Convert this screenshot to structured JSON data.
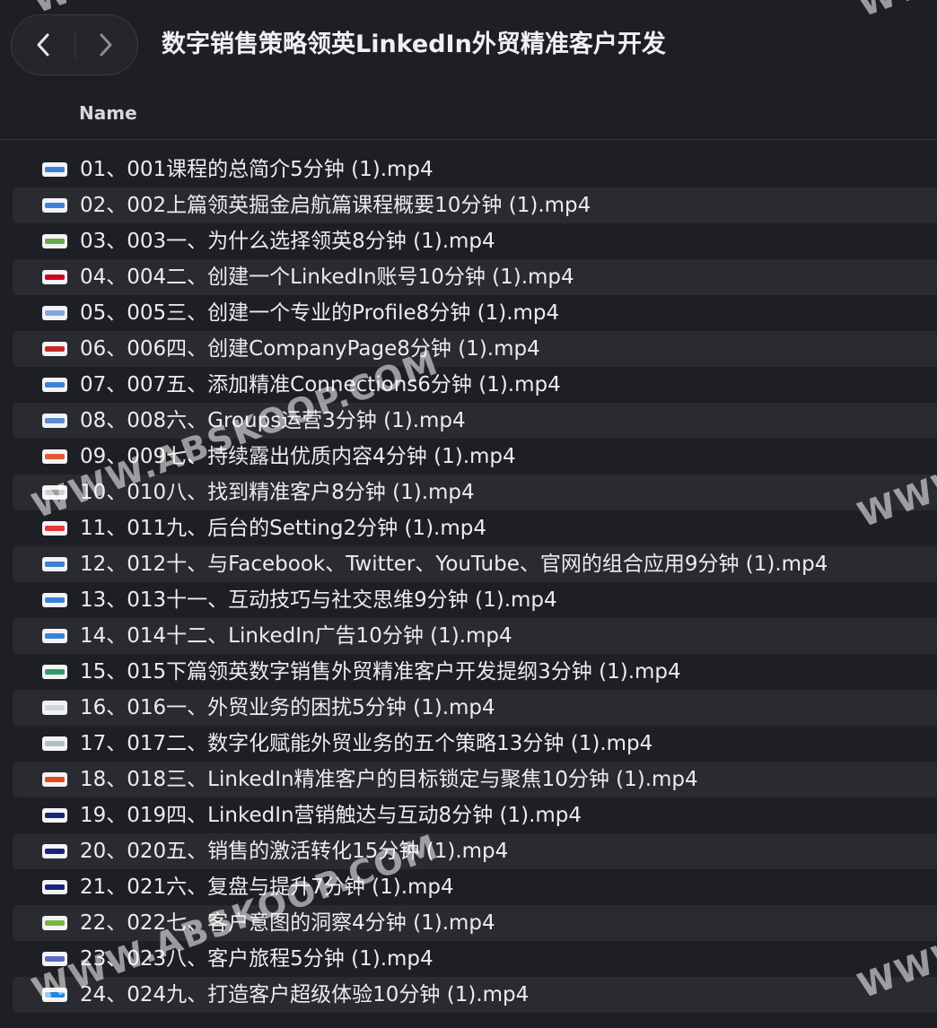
{
  "window": {
    "title": "数字销售策略领英LinkedIn外贸精准客户开发",
    "back_icon": "chevron-left-icon",
    "forward_icon": "chevron-right-icon"
  },
  "list": {
    "column_header": "Name",
    "files": [
      {
        "name": "01、001课程的总简介5分钟 (1).mp4",
        "icon_color": "#3b82d6"
      },
      {
        "name": "02、002上篇领英掘金启航篇课程概要10分钟 (1).mp4",
        "icon_color": "#3b82d6"
      },
      {
        "name": "03、003一、为什么选择领英8分钟 (1).mp4",
        "icon_color": "#6aa84f"
      },
      {
        "name": "04、004二、创建一个LinkedIn账号10分钟 (1).mp4",
        "icon_color": "#d0021b"
      },
      {
        "name": "05、005三、创建一个专业的Profile8分钟 (1).mp4",
        "icon_color": "#7fa7e0"
      },
      {
        "name": "06、006四、创建CompanyPage8分钟 (1).mp4",
        "icon_color": "#c62828"
      },
      {
        "name": "07、007五、添加精准Connections6分钟 (1).mp4",
        "icon_color": "#3b82d6"
      },
      {
        "name": "08、008六、Groups运营3分钟 (1).mp4",
        "icon_color": "#5b8bd0"
      },
      {
        "name": "09、009七、持续露出优质内容4分钟 (1).mp4",
        "icon_color": "#e05a3a"
      },
      {
        "name": "10、010八、找到精准客户8分钟 (1).mp4",
        "icon_color": "#9e9e9e"
      },
      {
        "name": "11、011九、后台的Setting2分钟 (1).mp4",
        "icon_color": "#e53935"
      },
      {
        "name": "12、012十、与Facebook、Twitter、YouTube、官网的组合应用9分钟 (1).mp4",
        "icon_color": "#3b82d6"
      },
      {
        "name": "13、013十一、互动技巧与社交思维9分钟 (1).mp4",
        "icon_color": "#3b82d6"
      },
      {
        "name": "14、014十二、LinkedIn广告10分钟 (1).mp4",
        "icon_color": "#3b82d6"
      },
      {
        "name": "15、015下篇领英数字销售外贸精准客户开发提纲3分钟 (1).mp4",
        "icon_color": "#2e9d6a"
      },
      {
        "name": "16、016一、外贸业务的困扰5分钟 (1).mp4",
        "icon_color": "#cfd8dc"
      },
      {
        "name": "17、017二、数字化赋能外贸业务的五个策略13分钟 (1).mp4",
        "icon_color": "#b0bec5"
      },
      {
        "name": "18、018三、LinkedIn精准客户的目标锁定与聚焦10分钟 (1).mp4",
        "icon_color": "#e64a19"
      },
      {
        "name": "19、019四、LinkedIn营销触达与互动8分钟 (1).mp4",
        "icon_color": "#1a237e"
      },
      {
        "name": "20、020五、销售的激活转化15分钟 (1).mp4",
        "icon_color": "#1a237e"
      },
      {
        "name": "21、021六、复盘与提升7分钟 (1).mp4",
        "icon_color": "#1a237e"
      },
      {
        "name": "22、022七、客户意图的洞察4分钟 (1).mp4",
        "icon_color": "#7cb342"
      },
      {
        "name": "23、023八、客户旅程5分钟 (1).mp4",
        "icon_color": "#5c6bc0"
      },
      {
        "name": "24、024九、打造客户超级体验10分钟 (1).mp4",
        "icon_color": "#1e88e5"
      }
    ]
  },
  "watermark": {
    "text_main": "WWW.ABSKOOP.COM",
    "text_partial": "WWW."
  }
}
